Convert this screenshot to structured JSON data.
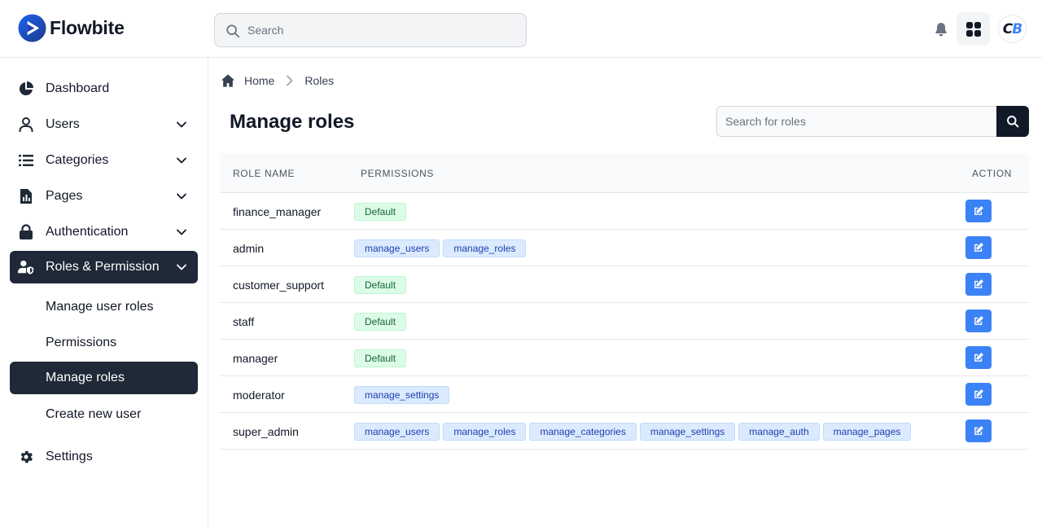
{
  "app": {
    "brand": "Flowbite",
    "avatar_initials_1": "C",
    "avatar_initials_2": "B"
  },
  "header": {
    "search_placeholder": "Search"
  },
  "sidebar": {
    "items": [
      {
        "label": "Dashboard",
        "icon": "chart-pie-icon",
        "has_chevron": false
      },
      {
        "label": "Users",
        "icon": "user-icon",
        "has_chevron": true
      },
      {
        "label": "Categories",
        "icon": "list-icon",
        "has_chevron": true
      },
      {
        "label": "Pages",
        "icon": "document-chart-icon",
        "has_chevron": true
      },
      {
        "label": "Authentication",
        "icon": "lock-icon",
        "has_chevron": true
      },
      {
        "label": "Roles & Permission",
        "icon": "user-shield-icon",
        "has_chevron": true,
        "active": true
      }
    ],
    "sub_items": [
      {
        "label": "Manage user roles"
      },
      {
        "label": "Permissions"
      },
      {
        "label": "Manage roles",
        "active": true
      },
      {
        "label": "Create new user"
      }
    ],
    "settings": {
      "label": "Settings",
      "icon": "gear-icon"
    }
  },
  "breadcrumb": {
    "home": "Home",
    "current": "Roles"
  },
  "main": {
    "title": "Manage roles",
    "search_placeholder": "Search for roles",
    "columns": [
      "Role name",
      "Permissions",
      "Action"
    ],
    "rows": [
      {
        "name": "finance_manager",
        "permissions": [
          "Default"
        ]
      },
      {
        "name": "admin",
        "permissions": [
          "manage_users",
          "manage_roles"
        ]
      },
      {
        "name": "customer_support",
        "permissions": [
          "Default"
        ]
      },
      {
        "name": "staff",
        "permissions": [
          "Default"
        ]
      },
      {
        "name": "manager",
        "permissions": [
          "Default"
        ]
      },
      {
        "name": "moderator",
        "permissions": [
          "manage_settings"
        ]
      },
      {
        "name": "super_admin",
        "permissions": [
          "manage_users",
          "manage_roles",
          "manage_categories",
          "manage_settings",
          "manage_auth",
          "manage_pages"
        ]
      }
    ]
  },
  "colors": {
    "accent": "#3b82f6",
    "active_nav": "#1f2937",
    "default_badge_bg": "#dcfce7",
    "perm_badge_bg": "#dbeafe"
  }
}
